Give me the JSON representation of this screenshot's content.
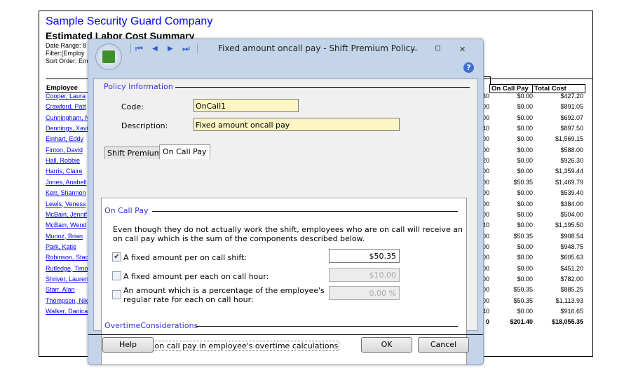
{
  "report": {
    "company": "Sample Security Guard Company",
    "title": "Estimated Labor Cost Summary",
    "date_range": "Date Range: 8",
    "filter": "Filter:(Employ",
    "sort_order": "Sort Order: Em",
    "headers": {
      "employee": "Employee",
      "on_call_pay": "On Call Pay",
      "total_cost": "Total Cost"
    },
    "rows": [
      {
        "employee": "Cooper, Laura",
        "partial": "30",
        "on_call_pay": "$0.00",
        "total_cost": "$427.20"
      },
      {
        "employee": "Crawford, Patt",
        "partial": "00",
        "on_call_pay": "$0.00",
        "total_cost": "$891.05"
      },
      {
        "employee": "Cunningham, N",
        "partial": "00",
        "on_call_pay": "$0.00",
        "total_cost": "$692.07"
      },
      {
        "employee": "Dennings, Xavi",
        "partial": "40",
        "on_call_pay": "$0.00",
        "total_cost": "$897.50"
      },
      {
        "employee": "Einhart, Eddy",
        "partial": "00",
        "on_call_pay": "$0.00",
        "total_cost": "$1,569.15"
      },
      {
        "employee": "Finton, David",
        "partial": "00",
        "on_call_pay": "$0.00",
        "total_cost": "$588.00"
      },
      {
        "employee": "Hall, Robbie",
        "partial": "20",
        "on_call_pay": "$0.00",
        "total_cost": "$926.30"
      },
      {
        "employee": "Harris, Claire",
        "partial": "00",
        "on_call_pay": "$0.00",
        "total_cost": "$1,359.44"
      },
      {
        "employee": "Jones, Anabell",
        "partial": "00",
        "on_call_pay": "$50.35",
        "total_cost": "$1,469.79"
      },
      {
        "employee": "Kerr, Shannon",
        "partial": "00",
        "on_call_pay": "$0.00",
        "total_cost": "$539.40"
      },
      {
        "employee": "Lewis, Veness",
        "partial": "00",
        "on_call_pay": "$0.00",
        "total_cost": "$384.00"
      },
      {
        "employee": "McBain, Jennif",
        "partial": "00",
        "on_call_pay": "$0.00",
        "total_cost": "$504.00"
      },
      {
        "employee": "McBain, Wend",
        "partial": "40",
        "on_call_pay": "$0.00",
        "total_cost": "$1,195.50"
      },
      {
        "employee": "Munoz, Brian",
        "partial": "00",
        "on_call_pay": "$50.35",
        "total_cost": "$908.54"
      },
      {
        "employee": "Park, Katie",
        "partial": "00",
        "on_call_pay": "$0.00",
        "total_cost": "$948.75"
      },
      {
        "employee": "Robinson, Stac",
        "partial": "00",
        "on_call_pay": "$0.00",
        "total_cost": "$605.63"
      },
      {
        "employee": "Rutledge, Timo",
        "partial": "00",
        "on_call_pay": "$0.00",
        "total_cost": "$451.20"
      },
      {
        "employee": "Shriver, Lauren",
        "partial": "00",
        "on_call_pay": "$0.00",
        "total_cost": "$782.00"
      },
      {
        "employee": "Starr, Alan",
        "partial": "00",
        "on_call_pay": "$50.35",
        "total_cost": "$885.25"
      },
      {
        "employee": "Thompson, Nik",
        "partial": "00",
        "on_call_pay": "$50.35",
        "total_cost": "$1,113.93"
      },
      {
        "employee": "Walker, Danica",
        "partial": "40",
        "on_call_pay": "$0.00",
        "total_cost": "$916.65"
      }
    ],
    "totals": {
      "partial": "0",
      "on_call_pay": "$201.40",
      "total_cost": "$18,055.35"
    }
  },
  "dialog": {
    "title": "Fixed amount oncall pay - Shift Premium Policy",
    "nav": {
      "first": "⏮",
      "prev": "◀",
      "next": "▶",
      "last": "⏭"
    },
    "window": {
      "minimize": "—",
      "restore": "▫",
      "close": "✕",
      "help": "?"
    },
    "policy_section": "Policy Information",
    "code_label": "Code:",
    "code_value": "OnCall1",
    "description_label": "Description:",
    "description_value": "Fixed amount oncall pay",
    "tabs": [
      {
        "label": "Shift Premiums",
        "active": false
      },
      {
        "label": "On Call Pay",
        "active": true
      }
    ],
    "on_call_section": "On Call Pay",
    "explanation": "Even though they do not actually work the shift, employees who are on call will receive an on call pay which is the sum of the components described below.",
    "options": [
      {
        "label": "A fixed amount per on call shift:",
        "checked": true,
        "value": "$50.35",
        "enabled": true
      },
      {
        "label": "A fixed amount per each on call hour:",
        "checked": false,
        "value": "$10.00",
        "enabled": false
      },
      {
        "label": "An amount which is a percentage of the employee's regular rate for each on call hour:",
        "checked": false,
        "value": "0.00 %",
        "enabled": false
      }
    ],
    "overtime_section": "OvertimeConsiderations",
    "overtime_option": {
      "label": "Include on call pay in employee's overtime calculations",
      "checked": false
    },
    "buttons": {
      "help": "Help",
      "ok": "OK",
      "cancel": "Cancel"
    }
  }
}
